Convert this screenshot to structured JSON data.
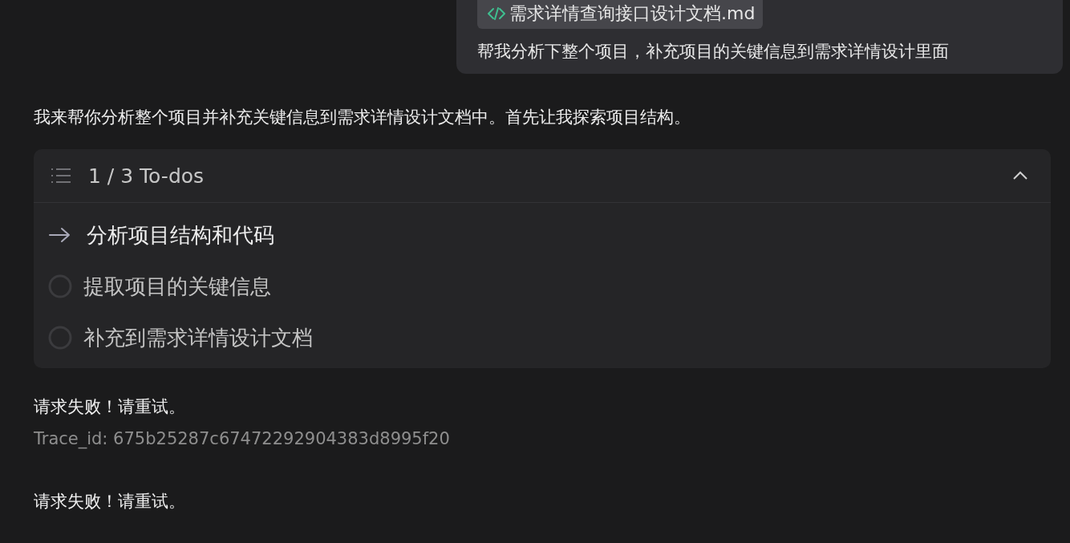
{
  "user_message": {
    "attachment": {
      "name": "需求详情查询接口设计文档.md"
    },
    "text": "帮我分析下整个项目，补充项目的关键信息到需求详情设计里面"
  },
  "assistant_intro": "我来帮你分析整个项目并补充关键信息到需求详情设计文档中。首先让我探索项目结构。",
  "todos": {
    "title": "1 / 3 To-dos",
    "expanded": true,
    "items": [
      {
        "kind": "current",
        "text": "分析项目结构和代码"
      },
      {
        "kind": "pending",
        "text": "提取项目的关键信息"
      },
      {
        "kind": "pending",
        "text": "补充到需求详情设计文档"
      }
    ]
  },
  "messages": [
    {
      "kind": "error",
      "text": "请求失败！请重试。"
    },
    {
      "kind": "trace",
      "text": "Trace_id: 675b25287c67472292904383d8995f20"
    },
    {
      "kind": "error",
      "text": "请求失败！请重试。"
    }
  ]
}
